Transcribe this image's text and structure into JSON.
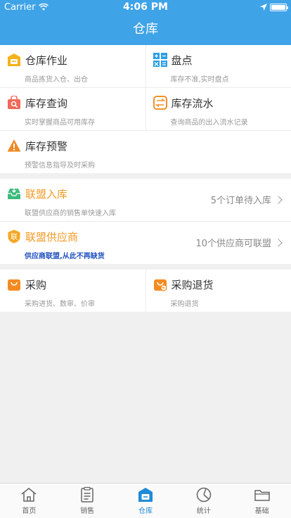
{
  "status": {
    "carrier": "Carrier",
    "time": "4:06 PM"
  },
  "title": "仓库",
  "grid1": {
    "warehouse_ops": {
      "title": "仓库作业",
      "sub": "商品拣货入仓、出仓"
    },
    "stocktake": {
      "title": "盘点",
      "sub": "库存不准,实时盘点"
    },
    "stock_query": {
      "title": "库存查询",
      "sub": "实时掌握商品可用库存"
    },
    "stock_flow": {
      "title": "库存流水",
      "sub": "查询商品的出入流水记录"
    },
    "stock_alert": {
      "title": "库存预警",
      "sub": "预警信息指导及时采购"
    }
  },
  "alliance": {
    "inbound": {
      "title": "联盟入库",
      "sub": "联盟供应商的销售单快速入库",
      "info": "5个订单待入库"
    },
    "supplier": {
      "title": "联盟供应商",
      "sub": "供应商联盟,从此不再缺货",
      "info": "10个供应商可联盟"
    }
  },
  "purchase": {
    "buy": {
      "title": "采购",
      "sub": "采购进货、数审、价审"
    },
    "return": {
      "title": "采购退货",
      "sub": "采购退货"
    }
  },
  "tabs": [
    {
      "label": "首页"
    },
    {
      "label": "销售"
    },
    {
      "label": "仓库"
    },
    {
      "label": "统计"
    },
    {
      "label": "基础"
    }
  ],
  "colors": {
    "header": "#3fa3e8",
    "accent_orange": "#f59a23",
    "tab_active": "#1f8bd8"
  },
  "icons": [
    "wifi-icon",
    "location-arrow-icon",
    "battery-icon",
    "warehouse-ops-icon",
    "calculator-icon",
    "search-bag-icon",
    "flow-icon",
    "warning-icon",
    "inbox-icon",
    "alliance-icon",
    "shopping-bag-icon",
    "return-bag-icon",
    "home-icon",
    "clipboard-icon",
    "warehouse-icon",
    "chart-icon",
    "folder-icon"
  ]
}
